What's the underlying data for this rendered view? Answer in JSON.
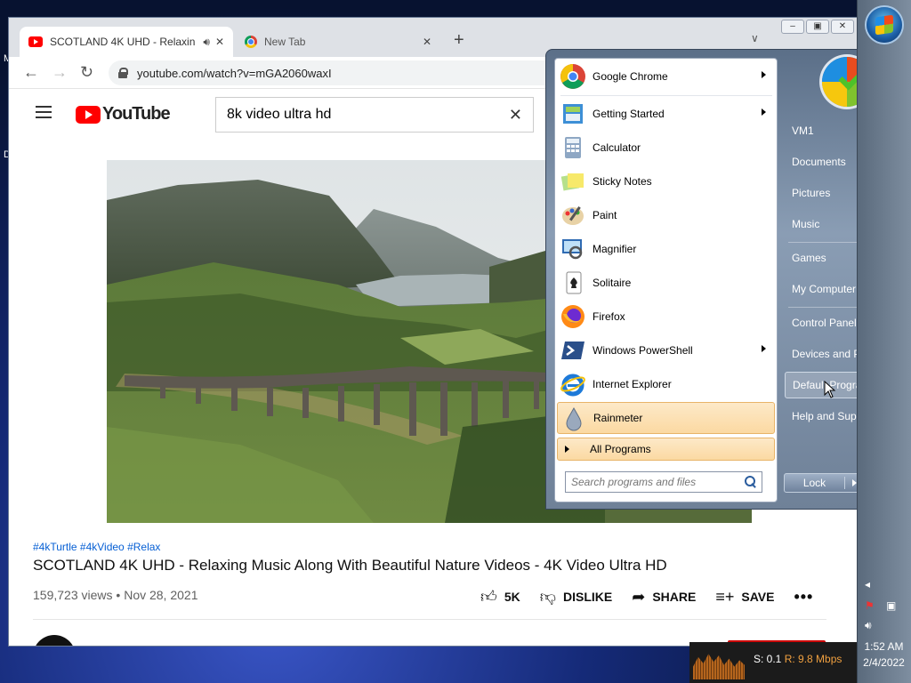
{
  "browser": {
    "tabs": [
      {
        "title": "SCOTLAND 4K UHD - Relaxin",
        "active": true
      },
      {
        "title": "New Tab",
        "active": false
      }
    ],
    "url": "youtube.com/watch?v=mGA2060waxI"
  },
  "youtube": {
    "logo_text": "YouTube",
    "search_value": "8k video ultra hd",
    "video": {
      "tags": "#4kTurtle #4kVideo #Relax",
      "title": "SCOTLAND 4K UHD - Relaxing Music Along With Beautiful Nature Videos - 4K Video Ultra HD",
      "views": "159,723 views",
      "date": "Nov 28, 2021",
      "likes": "5K",
      "dislike_label": "DISLIKE",
      "share_label": "SHARE",
      "save_label": "SAVE"
    }
  },
  "start_menu": {
    "programs": [
      {
        "label": "Google Chrome",
        "icon": "chrome-icon",
        "submenu": true
      },
      {
        "label": "Getting Started",
        "icon": "getting-started-icon",
        "submenu": true
      },
      {
        "label": "Calculator",
        "icon": "calculator-icon",
        "submenu": false
      },
      {
        "label": "Sticky Notes",
        "icon": "sticky-notes-icon",
        "submenu": false
      },
      {
        "label": "Paint",
        "icon": "paint-icon",
        "submenu": false
      },
      {
        "label": "Magnifier",
        "icon": "magnifier-icon",
        "submenu": false
      },
      {
        "label": "Solitaire",
        "icon": "solitaire-icon",
        "submenu": false
      },
      {
        "label": "Firefox",
        "icon": "firefox-icon",
        "submenu": false
      },
      {
        "label": "Windows PowerShell",
        "icon": "powershell-icon",
        "submenu": true
      },
      {
        "label": "Internet Explorer",
        "icon": "internet-explorer-icon",
        "submenu": false
      },
      {
        "label": "Rainmeter",
        "icon": "rainmeter-icon",
        "submenu": false
      }
    ],
    "all_programs": "All Programs",
    "search_placeholder": "Search programs and files",
    "right_items": [
      "VM1",
      "Documents",
      "Pictures",
      "Music",
      "Games",
      "My Computer",
      "Control Panel",
      "Devices and Printers",
      "Default Programs",
      "Help and Support"
    ],
    "lock_label": "Lock"
  },
  "taskbar": {
    "time": "1:52 AM",
    "date": "2/4/2022"
  },
  "net_meter": {
    "sent": "S: 0.1",
    "received": "R: 9.8 Mbps"
  },
  "desktop_fragments": [
    "M",
    "D"
  ]
}
